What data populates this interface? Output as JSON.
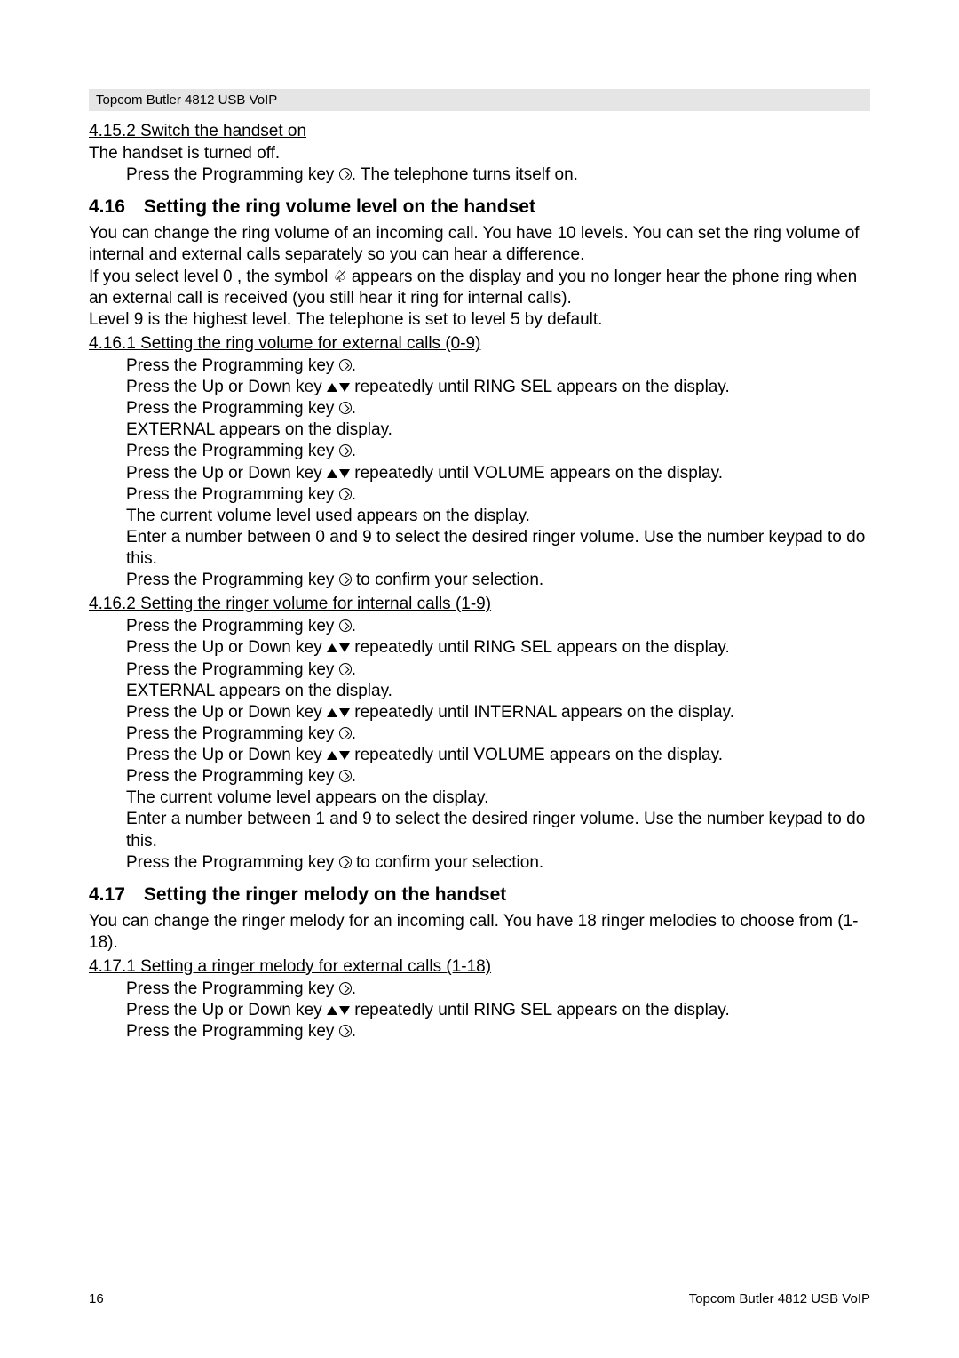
{
  "header": "Topcom Butler 4812 USB VoIP",
  "s4152": {
    "title": "4.15.2 Switch the handset on",
    "line1": "The handset is turned off.",
    "line2a": "Press the Programming key ",
    "line2b": ". The telephone turns itself on."
  },
  "s416": {
    "heading": "4.16 Setting the ring volume level on the handset",
    "p1": "You can change the ring volume of an incoming call. You have 10 levels. You can set the ring volume of internal and external calls separately so you can hear a difference.",
    "p2a": "If you select level  0 , the symbol ",
    "p2b": " appears on the display and you no longer hear the phone ring when an external call is received (you still hear it ring for internal calls).",
    "p3": "Level  9  is the highest level. The telephone is set to level  5  by default.",
    "sub1": "4.16.1 Setting the ring volume for external calls (0-9)",
    "sub1_steps": {
      "a1": "Press the Programming key ",
      "a2": ".",
      "b1": "Press the Up or Down key ",
      "b2": " repeatedly until  RING SEL  appears on the display.",
      "c1": "Press the Programming key ",
      "c2": ".",
      "d": " EXTERNAL  appears on the display.",
      "e1": "Press the Programming key ",
      "e2": ".",
      "f1": "Press the Up or Down key ",
      "f2": " repeatedly until  VOLUME  appears on the display.",
      "g1": "Press the Programming key ",
      "g2": ".",
      "h": "The current volume level used appears on the display.",
      "i": "Enter a number between 0 and 9 to select the desired ringer volume. Use the number keypad to do this.",
      "j1": "Press the Programming key ",
      "j2": " to confirm your selection."
    },
    "sub2": "4.16.2 Setting the ringer volume for internal calls (1-9)",
    "sub2_steps": {
      "a1": "Press the Programming key ",
      "a2": ".",
      "b1": "Press the Up or Down key ",
      "b2": " repeatedly until  RING SEL  appears on the display.",
      "c1": "Press the Programming key ",
      "c2": ".",
      "d": " EXTERNAL  appears on the display.",
      "e1": "Press the Up or Down key ",
      "e2": " repeatedly until  INTERNAL  appears on the display.",
      "f1": "Press the Programming key ",
      "f2": ".",
      "g1": "Press the Up or Down key ",
      "g2": " repeatedly until  VOLUME  appears on the display.",
      "h1": "Press the Programming key ",
      "h2": ".",
      "i": "The current volume level appears on the display.",
      "j": "Enter a number between 1 and 9 to select the desired ringer volume. Use the number keypad to do this.",
      "k1": "Press the Programming key ",
      "k2": " to confirm your selection."
    }
  },
  "s417": {
    "heading": "4.17 Setting the ringer melody on the handset",
    "p1": "You can change the ringer melody for an incoming call. You have 18 ringer melodies to choose from (1-18).",
    "sub1": "4.17.1 Setting a ringer melody for external calls (1-18)",
    "sub1_steps": {
      "a1": "Press the Programming key ",
      "a2": ".",
      "b1": "Press the Up or Down key ",
      "b2": " repeatedly until  RING SEL  appears on the display.",
      "c1": "Press the Programming key ",
      "c2": "."
    }
  },
  "footer": {
    "page": "16",
    "product": "Topcom Butler 4812 USB VoIP"
  }
}
